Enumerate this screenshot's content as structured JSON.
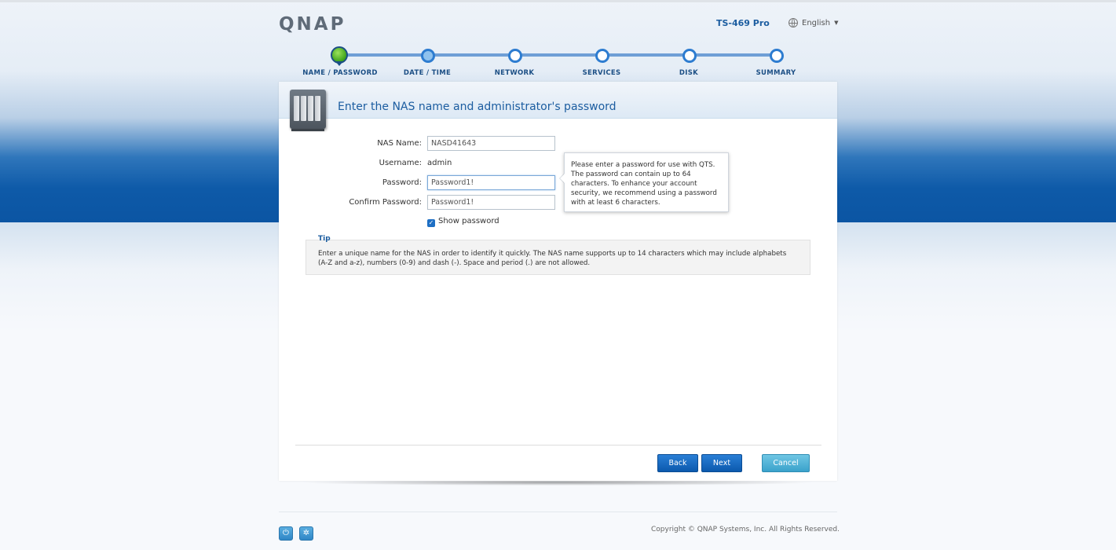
{
  "header": {
    "logo": "QNAP",
    "model": "TS-469 Pro",
    "language": "English"
  },
  "steps": [
    {
      "label": "NAME / PASSWORD",
      "state": "current"
    },
    {
      "label": "DATE / TIME",
      "state": "done"
    },
    {
      "label": "NETWORK",
      "state": "pending"
    },
    {
      "label": "SERVICES",
      "state": "pending"
    },
    {
      "label": "DISK",
      "state": "pending"
    },
    {
      "label": "SUMMARY",
      "state": "pending"
    }
  ],
  "panel": {
    "title": "Enter the NAS name and administrator's password"
  },
  "form": {
    "nas_name_label": "NAS Name:",
    "nas_name_value": "NASD41643",
    "username_label": "Username:",
    "username_value": "admin",
    "password_label": "Password:",
    "password_value": "Password1!",
    "confirm_label": "Confirm Password:",
    "confirm_value": "Password1!",
    "show_password_label": "Show password",
    "show_password_checked": true
  },
  "tooltip": {
    "text": "Please enter a password for use with QTS. The password can contain up to 64 characters. To enhance your account security, we recommend using a password with at least 6 characters."
  },
  "tip": {
    "title": "Tip",
    "text": "Enter a unique name for the NAS in order to identify it quickly. The NAS name supports up to 14 characters which may include alphabets (A-Z and a-z), numbers (0-9) and dash (-). Space and period (.) are not allowed."
  },
  "buttons": {
    "back": "Back",
    "next": "Next",
    "cancel": "Cancel"
  },
  "footer": {
    "copyright": "Copyright © QNAP Systems, Inc. All Rights Reserved.",
    "icons": [
      "power-icon",
      "settings-icon"
    ]
  },
  "colors": {
    "accent": "#1c5da0",
    "button_blue": "#0b59ad",
    "button_cancel": "#3aa2cb",
    "step_current": "#3ea31a"
  }
}
